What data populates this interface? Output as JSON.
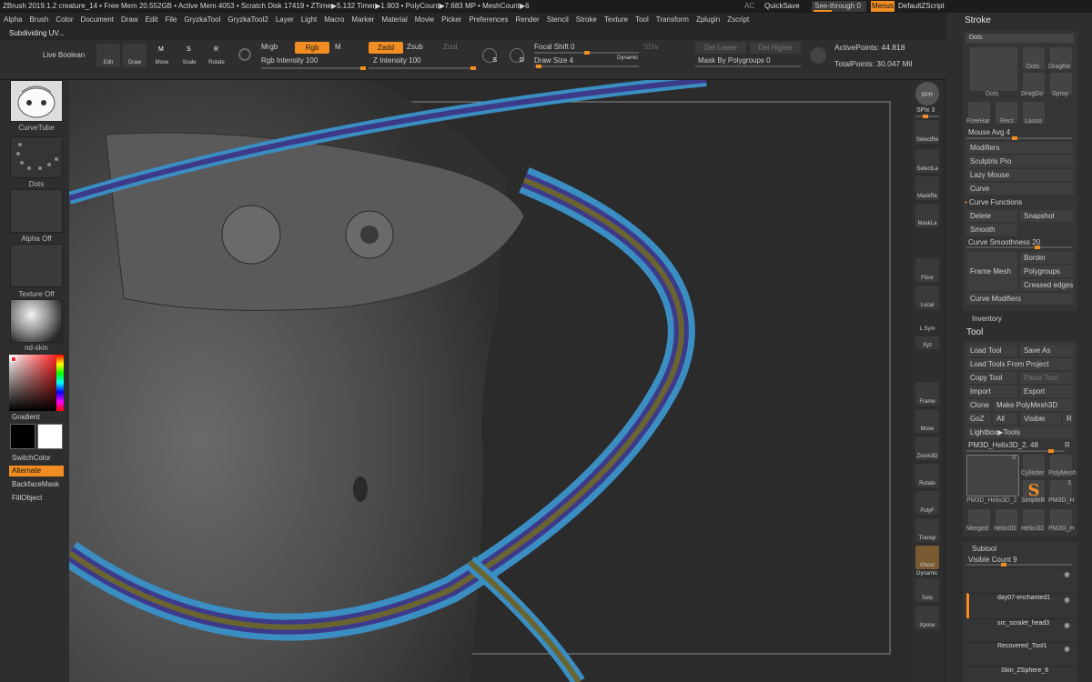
{
  "titlebar": {
    "text": "ZBrush 2019.1.2   creature_14   • Free Mem 20.552GB • Active Mem 4053 • Scratch Disk 17419 • ZTime▶5.132 Timer▶1.903 • PolyCount▶7.683 MP • MeshCount▶6",
    "ac": "AC",
    "quicksave": "QuickSave",
    "see_through": "See-through",
    "see_through_val": "0",
    "menus": "Menus",
    "default_zscript": "DefaultZScript"
  },
  "menu": [
    "Alpha",
    "Brush",
    "Color",
    "Document",
    "Draw",
    "Edit",
    "File",
    "GryzkaTool",
    "GryzkaTool2",
    "Layer",
    "Light",
    "Macro",
    "Marker",
    "Material",
    "Movie",
    "Picker",
    "Preferences",
    "Render",
    "Stencil",
    "Stroke",
    "Texture",
    "Tool",
    "Transform",
    "Zplugin",
    "Zscript"
  ],
  "status": "Subdividing UV...",
  "shelf": {
    "live_boolean": "Live Boolean",
    "edit": "Edit",
    "draw": "Draw",
    "move": "Move",
    "scale": "Scale",
    "rotate": "Rotate",
    "m_key": "M",
    "s_key": "S",
    "r_key": "R",
    "mrgb": "Mrgb",
    "rgb": "Rgb",
    "m": "M",
    "rgb_intensity": "Rgb Intensity 100",
    "zadd": "Zadd",
    "zsub": "Zsub",
    "zcut": "Zcut",
    "z_intensity": "Z Intensity 100",
    "focal_shift": "Focal Shift 0",
    "draw_size": "Draw Size 4",
    "dynamic": "Dynamic",
    "sdiv": "SDiv",
    "del_lower": "Del Lower",
    "del_higher": "Del Higher",
    "mask_by_polygroups": "Mask By Polygroups 0",
    "active_points": "ActivePoints: 44.818",
    "total_points": "TotalPoints: 30.047 Mil",
    "s_badge": "S",
    "d_badge": "D"
  },
  "left": {
    "brush": "CurveTube",
    "stroke": "Dots",
    "alpha": "Alpha Off",
    "texture": "Texture Off",
    "material": "nd-skin",
    "gradient": "Gradient",
    "switchcolor": "SwitchColor",
    "alternate": "Alternate",
    "backfacemask": "BackfaceMask",
    "fillobject": "FillObject"
  },
  "rightshelf": [
    "BPR",
    "SPix 3",
    "SelectRe",
    "SelectLa",
    "MaskRe",
    "MaskLa",
    "Floor",
    "Local",
    "L.Sym",
    "Xyz",
    "Frame",
    "Move",
    "Zoom3D",
    "Rotate",
    "PolyF",
    "Transp",
    "Ghost",
    "Dynamic",
    "Solo",
    "Xpose"
  ],
  "stroke_panel": {
    "title": "Stroke",
    "dots": "Dots",
    "dots2": "Dots",
    "dragrect": "DragRe",
    "dots3": "Dots",
    "dragdot": "DragDo",
    "spray": "Spray",
    "freehand": "FreeHar",
    "rect": "Rect",
    "lasso": "Lasso",
    "mouse_avg": "Mouse Avg 4",
    "modifiers": "Modifiers",
    "sculptris_pro": "Sculptris Pro",
    "lazy_mouse": "Lazy Mouse",
    "curve": "Curve",
    "curve_functions": "Curve Functions",
    "delete": "Delete",
    "snapshot": "Snapshot",
    "smooth": "Smooth",
    "curve_smoothness": "Curve Smoothness",
    "curve_smoothness_val": "20",
    "frame_mesh": "Frame Mesh",
    "border": "Border",
    "polygroups": "Polygroups",
    "creased_edges": "Creased edges",
    "curve_modifiers": "Curve Modifiers"
  },
  "inventory": "Inventory",
  "tool_panel": {
    "title": "Tool",
    "load_tool": "Load Tool",
    "save_as": "Save As",
    "load_tools_from_project": "Load Tools From Project",
    "copy_tool": "Copy Tool",
    "paste_tool": "Paste Tool",
    "import": "Import",
    "export": "Export",
    "clone": "Clone",
    "make_polymesh": "Make PolyMesh3D",
    "goz": "GoZ",
    "all": "All",
    "visible": "Visible",
    "r": "R",
    "lightbox_tools": "Lightbox▶Tools",
    "current_tool": "PM3D_Helix3D_2. 48",
    "r2": "R",
    "thumb_count": "3",
    "thumbs": [
      "PM3D_Helix3D_2",
      "Cylinder",
      "PolyMesh",
      "SimpleB",
      "PM3D_H",
      "Merged",
      "Helix3D",
      "Helix3D",
      "PM3D_H"
    ],
    "thumb_count2": "3"
  },
  "subtool": {
    "title": "Subtool",
    "visible_count": "Visible Count 9",
    "items": [
      "",
      "day07-enchanted1",
      "src_scralet_head3",
      "Recovered_Tool1",
      "Skin_ZSphere_6"
    ]
  }
}
